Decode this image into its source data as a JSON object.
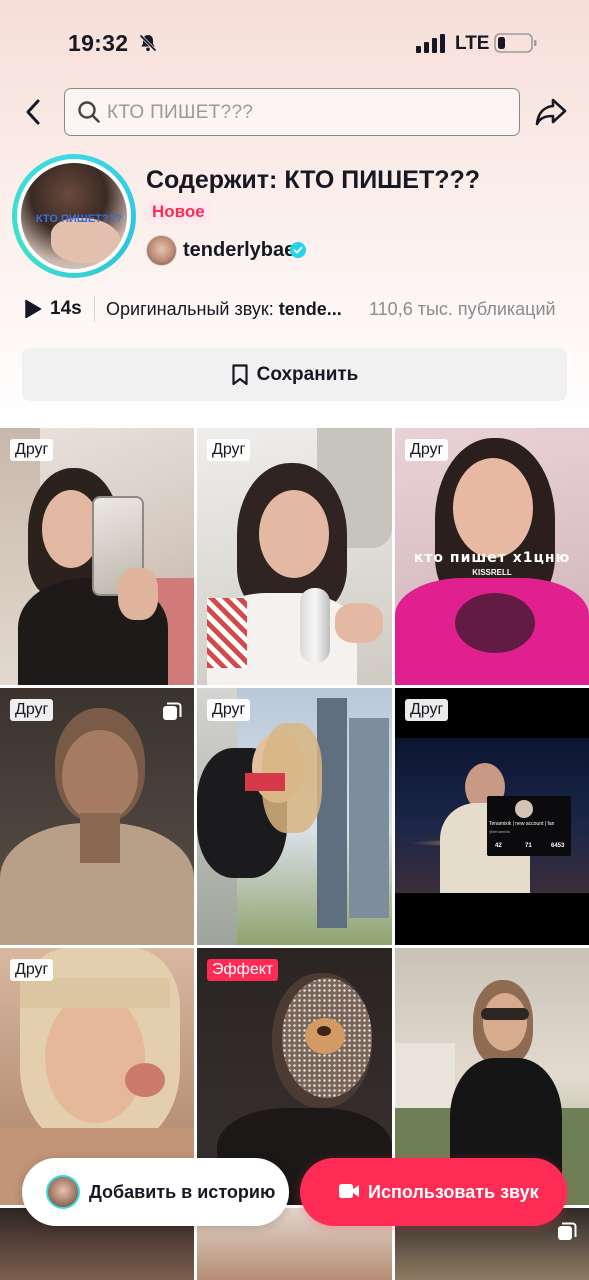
{
  "status_bar": {
    "time": "19:32",
    "network": "LTE"
  },
  "header": {
    "search_placeholder": "КТО ПИШЕТ???"
  },
  "sound": {
    "cover_text": "КТО ПИШЕТ???",
    "title": "Содержит: КТО ПИШЕТ???",
    "badge": "Новое",
    "author": "tenderlybae",
    "duration": "14s",
    "original_prefix": "Оригинальный звук: ",
    "original_author": "tende...",
    "publications": "110,6 тыс. публикаций"
  },
  "save_button": {
    "label": "Сохранить"
  },
  "grid": [
    {
      "badge": "Друг",
      "multi": false
    },
    {
      "badge": "Друг",
      "multi": false
    },
    {
      "badge": "Друг",
      "multi": false,
      "overlay_text": "кто пишет х1цню",
      "overlay_sub": "KISSRELL"
    },
    {
      "badge": "Друг",
      "multi": true
    },
    {
      "badge": "Друг",
      "multi": false
    },
    {
      "badge": "Друг",
      "multi": false,
      "card_name": "Tenamixik | new account | fan",
      "card_handle": "@tenamixik",
      "card_stats": [
        "42",
        "71",
        "6453"
      ]
    },
    {
      "badge": "Друг",
      "multi": false
    },
    {
      "badge": "Эффект",
      "multi": false
    },
    {
      "badge": "",
      "multi": false
    }
  ],
  "bottom": {
    "story_label": "Добавить в историю",
    "use_label": "Использовать звук"
  },
  "colors": {
    "accent": "#fe2c55",
    "ring": "#3bd9e6",
    "verified": "#20d5ec"
  }
}
